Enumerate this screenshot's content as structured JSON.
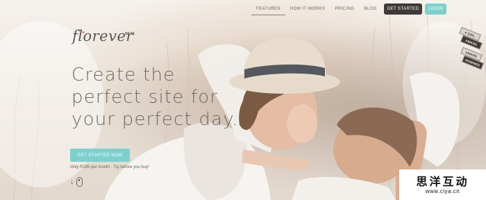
{
  "nav": {
    "items": [
      {
        "label": "FEATURES",
        "active": true
      },
      {
        "label": "HOW IT WORKS",
        "active": false
      },
      {
        "label": "PRICING",
        "active": false
      },
      {
        "label": "BLOG",
        "active": false
      }
    ],
    "get_started_label": "GET STARTED",
    "login_label": "LOGIN"
  },
  "logo": {
    "text": "florever",
    "beta": "BETA"
  },
  "hero": {
    "headline": [
      "Create the",
      "perfect site for",
      "your perfect day."
    ],
    "cta_label": "GET STARTED NOW",
    "price_text": "Only R195 per month - Try before you buy!"
  },
  "badges": [
    {
      "label": "♥ GIRL",
      "dark": false
    },
    {
      "label": "AWARD",
      "dark": true
    },
    {
      "label": "AWARD",
      "dark": false
    },
    {
      "label": "NOMINEE",
      "dark": true
    }
  ],
  "watermark": {
    "chinese": "思洋互动",
    "url": "www.ciya.cn"
  },
  "colors": {
    "accent": "#7ed0cd",
    "dark": "#3f3a37",
    "text": "#6f6863",
    "heart": "#e07a84"
  }
}
